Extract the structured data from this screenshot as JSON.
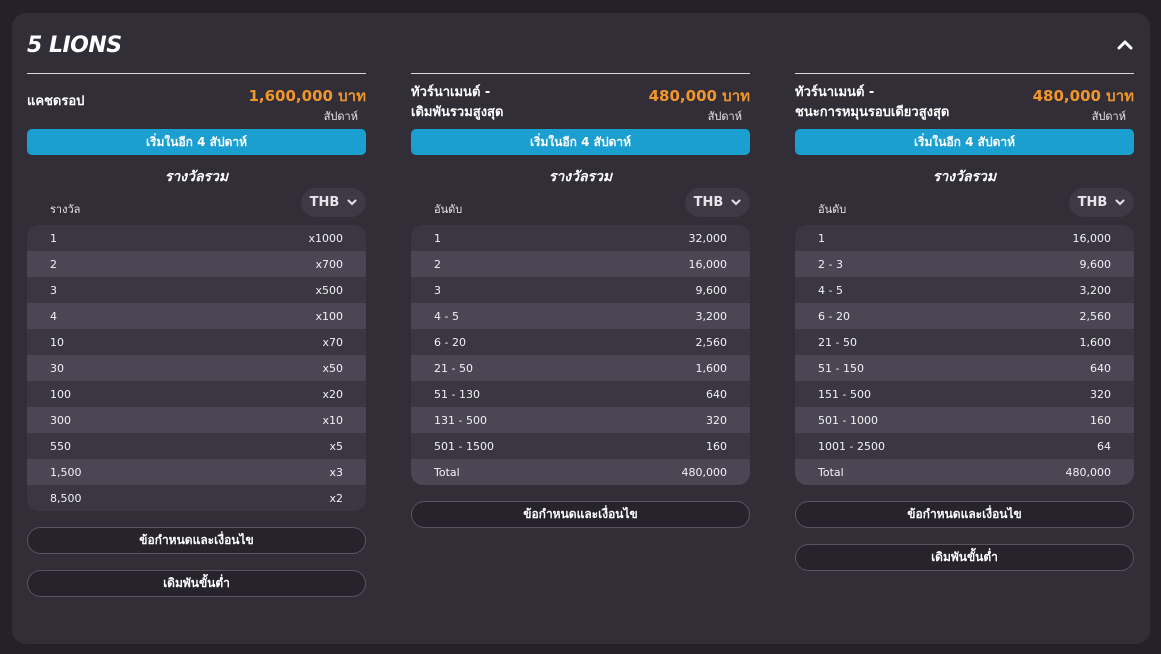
{
  "panel": {
    "title": "5 LIONS"
  },
  "columns": [
    {
      "name_lines": [
        "แคชดรอป"
      ],
      "prize": "1,600,000 บาท",
      "period": "สัปดาห์",
      "start": "เริ่มในอีก 4 สัปดาห์",
      "pool_title": "รางวัลรวม",
      "table_label": "รางวัล",
      "currency": "THB",
      "rows": [
        [
          "1",
          "x1000"
        ],
        [
          "2",
          "x700"
        ],
        [
          "3",
          "x500"
        ],
        [
          "4",
          "x100"
        ],
        [
          "10",
          "x70"
        ],
        [
          "30",
          "x50"
        ],
        [
          "100",
          "x20"
        ],
        [
          "300",
          "x10"
        ],
        [
          "550",
          "x5"
        ],
        [
          "1,500",
          "x3"
        ],
        [
          "8,500",
          "x2"
        ]
      ],
      "buttons": [
        "ข้อกำหนดและเงื่อนไข",
        "เดิมพันขั้นต่ำ"
      ]
    },
    {
      "name_lines": [
        "ทัวร์นาเมนต์ -",
        "เดิมพันรวมสูงสุด"
      ],
      "prize": "480,000 บาท",
      "period": "สัปดาห์",
      "start": "เริ่มในอีก 4 สัปดาห์",
      "pool_title": "รางวัลรวม",
      "table_label": "อันดับ",
      "currency": "THB",
      "rows": [
        [
          "1",
          "32,000"
        ],
        [
          "2",
          "16,000"
        ],
        [
          "3",
          "9,600"
        ],
        [
          "4 - 5",
          "3,200"
        ],
        [
          "6 - 20",
          "2,560"
        ],
        [
          "21 - 50",
          "1,600"
        ],
        [
          "51 - 130",
          "640"
        ],
        [
          "131 - 500",
          "320"
        ],
        [
          "501 - 1500",
          "160"
        ],
        [
          "Total",
          "480,000"
        ]
      ],
      "buttons": [
        "ข้อกำหนดและเงื่อนไข"
      ]
    },
    {
      "name_lines": [
        "ทัวร์นาเมนต์ -",
        "ชนะการหมุนรอบเดียวสูงสุด"
      ],
      "prize": "480,000 บาท",
      "period": "สัปดาห์",
      "start": "เริ่มในอีก 4 สัปดาห์",
      "pool_title": "รางวัลรวม",
      "table_label": "อันดับ",
      "currency": "THB",
      "rows": [
        [
          "1",
          "16,000"
        ],
        [
          "2 - 3",
          "9,600"
        ],
        [
          "4 - 5",
          "3,200"
        ],
        [
          "6 - 20",
          "2,560"
        ],
        [
          "21 - 50",
          "1,600"
        ],
        [
          "51 - 150",
          "640"
        ],
        [
          "151 - 500",
          "320"
        ],
        [
          "501 - 1000",
          "160"
        ],
        [
          "1001 - 2500",
          "64"
        ],
        [
          "Total",
          "480,000"
        ]
      ],
      "buttons": [
        "ข้อกำหนดและเงื่อนไข",
        "เดิมพันขั้นต่ำ"
      ]
    }
  ]
}
